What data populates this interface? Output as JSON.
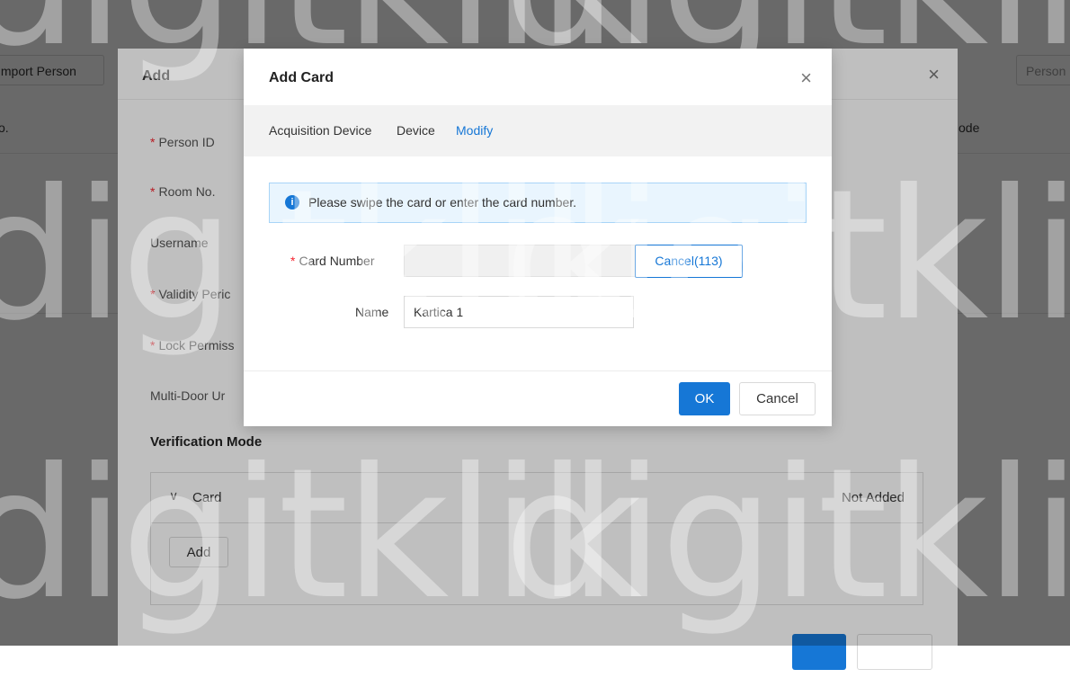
{
  "background": {
    "import_button": "Import Person",
    "person_search_placeholder": "Person",
    "column_left": "o.",
    "column_right": "ode"
  },
  "add_dialog": {
    "title": "Add",
    "close_symbol": "×",
    "fields": {
      "person_id": "Person ID",
      "room_no": "Room No.",
      "username": "Username",
      "validity_period": "Validity Peric",
      "lock_permission": "Lock Permiss",
      "multi_door": "Multi-Door Ur"
    },
    "required_mark": "*",
    "verification_title": "Verification Mode",
    "card_section": {
      "chevron": "∨",
      "label": "Card",
      "status": "Not Added",
      "add_button": "Add"
    }
  },
  "card_dialog": {
    "title": "Add Card",
    "close_symbol": "×",
    "acquisition_label": "Acquisition Device",
    "acquisition_value": "Device",
    "modify_link": "Modify",
    "info_icon": "i",
    "info_text": "Please swipe the card or enter the card number.",
    "card_number_label": "Card Number",
    "card_number_value": "",
    "cancel_count_button": "Cancel(113)",
    "name_label": "Name",
    "name_value": "Kartica 1",
    "ok_button": "OK",
    "cancel_button": "Cancel"
  },
  "watermark": {
    "text": "digitklik"
  },
  "colors": {
    "primary": "#1677d6",
    "required": "#f5222d",
    "info_background": "#e9f5fe"
  }
}
